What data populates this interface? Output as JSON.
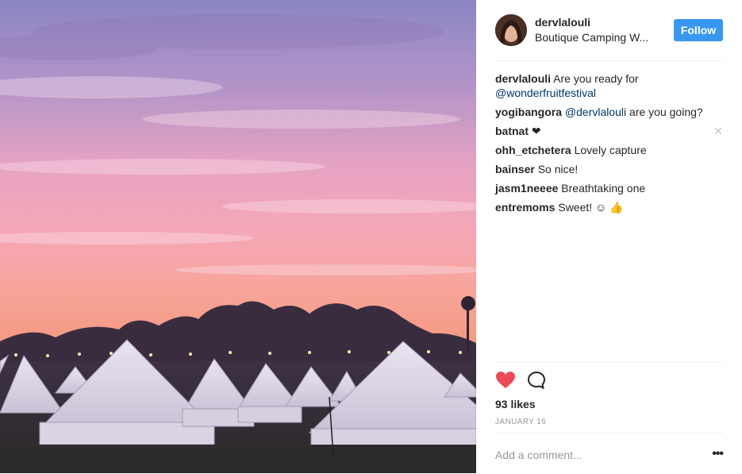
{
  "header": {
    "username": "dervlalouli",
    "location": "Boutique Camping W...",
    "follow_label": "Follow"
  },
  "comments": [
    {
      "user": "dervlalouli",
      "pre": "Are you ready for",
      "mention": "@wonderfruitfestival",
      "post": ""
    },
    {
      "user": "yogibangora",
      "pre": "",
      "mention": "@dervlalouli",
      "post": "are you going?"
    },
    {
      "user": "batnat",
      "pre": "❤",
      "mention": "",
      "post": ""
    },
    {
      "user": "ohh_etchetera",
      "pre": "Lovely capture",
      "mention": "",
      "post": ""
    },
    {
      "user": "bainser",
      "pre": "So nice!",
      "mention": "",
      "post": ""
    },
    {
      "user": "jasm1neeee",
      "pre": "Breathtaking one",
      "mention": "",
      "post": ""
    },
    {
      "user": "entremoms",
      "pre": "Sweet! ☺ 👍",
      "mention": "",
      "post": ""
    }
  ],
  "close_glyph": "✕",
  "actions": {
    "like_icon": "heart-icon",
    "comment_icon": "comment-icon",
    "likes_text": "93 likes",
    "date": "JANUARY 16"
  },
  "add_comment": {
    "placeholder": "Add a comment...",
    "more_label": "•••"
  },
  "colors": {
    "accent": "#3897f0",
    "heart": "#ed4956",
    "mention": "#003569"
  }
}
